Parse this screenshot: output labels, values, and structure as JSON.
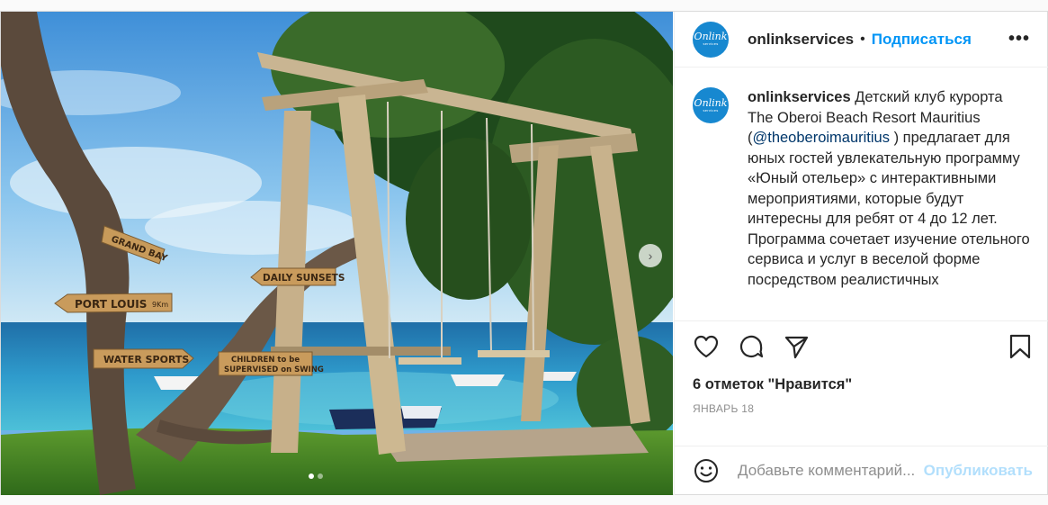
{
  "colors": {
    "accent": "#0095f6",
    "publish_disabled": "#b2dffc",
    "brand_avatar": "#1788d0",
    "muted": "#8e8e8e"
  },
  "media": {
    "image_alt": "Детский клуб курорта: деревянные качели на берегу моря",
    "signs": {
      "grand_bay": "GRAND BAY",
      "daily_sunsets": "DAILY SUNSETS",
      "port_louis": "PORT LOUIS",
      "port_louis_distance": "9Km",
      "water_sports": "WATER SPORTS",
      "children_line1": "CHILDREN to be",
      "children_line2": "SUPERVISED on SWING"
    },
    "next_icon": "chevron-right-icon",
    "carousel": {
      "count": 2,
      "active": 1
    }
  },
  "header": {
    "avatar_text": "Onlink",
    "avatar_subtext": "services",
    "username": "onlinkservices",
    "separator": "•",
    "follow_label": "Подписаться",
    "more_icon": "more-icon",
    "more_label": "•••"
  },
  "caption": {
    "username": "onlinkservices",
    "text_part1": " Детский клуб курорта The Oberoi Beach Resort Mauritius (",
    "mention": "@theoberoimauritius",
    "text_part2": " ) предлагает для юных гостей увлекательную программу «Юный отельер» с интерактивными мероприятиями, которые будут интересны для ребят от 4 до 12 лет.",
    "text_part3": "Программа сочетает изучение отельного сервиса и услуг в веселой форме посредством реалистичных"
  },
  "actions": {
    "like_icon": "heart-icon",
    "comment_icon": "comment-icon",
    "share_icon": "paper-plane-icon",
    "save_icon": "bookmark-icon"
  },
  "likes": "6 отметок \"Нравится\"",
  "date": "ЯНВАРЬ 18",
  "comment": {
    "emoji_icon": "smiley-icon",
    "placeholder": "Добавьте комментарий...",
    "publish_label": "Опубликовать"
  }
}
